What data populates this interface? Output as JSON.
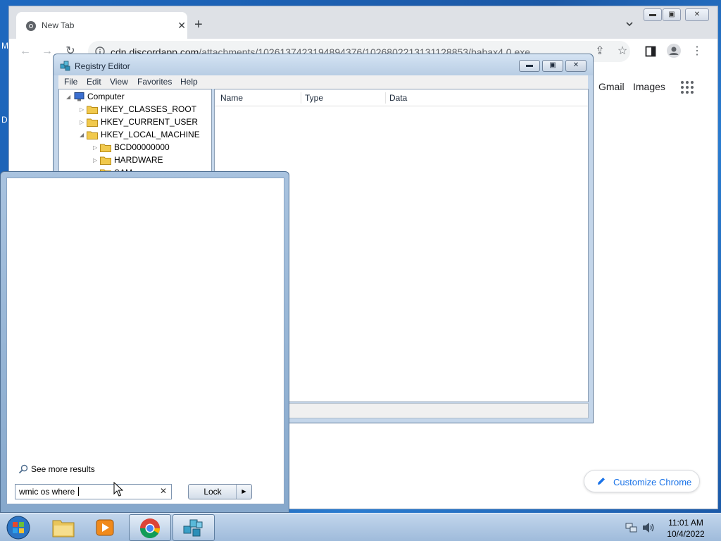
{
  "desktop": {
    "icon_fragment_1": "M",
    "icon_fragment_2": "D"
  },
  "chrome": {
    "tab_title": "New Tab",
    "url_host": "cdn.discordapp.com",
    "url_path": "/attachments/1026137423194894376/1026802213131128853/babax4.0.exe",
    "gmail_link": "Gmail",
    "images_link": "Images",
    "customize_label": "Customize Chrome"
  },
  "regedit": {
    "title": "Registry Editor",
    "menu": [
      "File",
      "Edit",
      "View",
      "Favorites",
      "Help"
    ],
    "tree": [
      "Computer",
      "HKEY_CLASSES_ROOT",
      "HKEY_CURRENT_USER",
      "HKEY_LOCAL_MACHINE",
      "BCD00000000",
      "HARDWARE",
      "SAM"
    ],
    "columns": [
      "Name",
      "Type",
      "Data"
    ]
  },
  "startmenu": {
    "see_more": "See more results",
    "search_value": "wmic os where ",
    "lock_label": "Lock"
  },
  "taskbar": {
    "time": "11:01 AM",
    "date": "10/4/2022"
  }
}
